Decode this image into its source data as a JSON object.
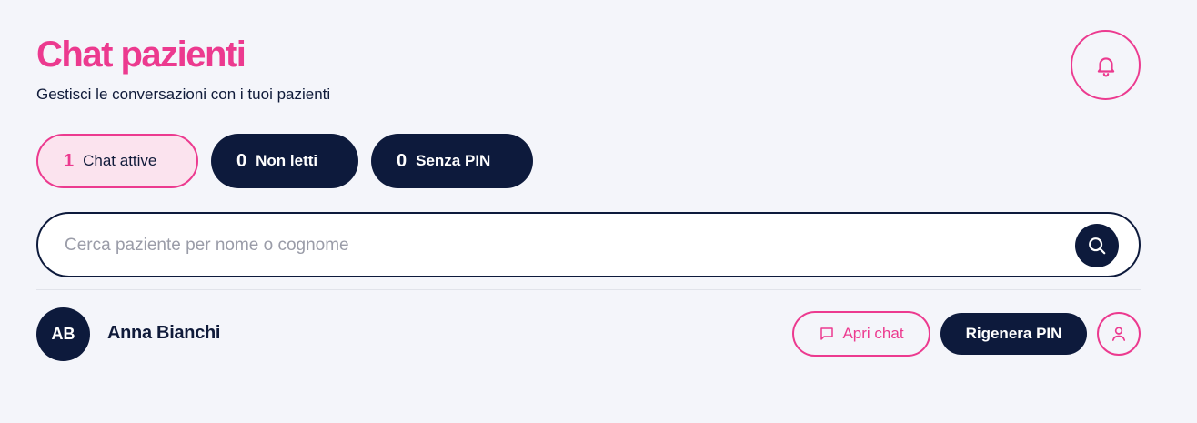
{
  "header": {
    "title": "Chat pazienti",
    "subtitle": "Gestisci le conversazioni con i tuoi pazienti",
    "notifications_icon": "bell-icon"
  },
  "filters": [
    {
      "count": "1",
      "label": "Chat attive",
      "active": true
    },
    {
      "count": "0",
      "label": "Non letti",
      "active": false
    },
    {
      "count": "0",
      "label": "Senza PIN",
      "active": false
    }
  ],
  "search": {
    "placeholder": "Cerca paziente per nome o cognome",
    "value": "",
    "icon": "search-icon"
  },
  "patients": [
    {
      "initials": "AB",
      "name": "Anna Bianchi",
      "open_chat_label": "Apri chat",
      "open_chat_icon": "chat-bubble-icon",
      "regen_pin_label": "Rigenera PIN",
      "profile_icon": "user-icon"
    }
  ],
  "colors": {
    "accent": "#ec3a8f",
    "dark": "#0d1a3c",
    "background": "#f4f5fa"
  }
}
